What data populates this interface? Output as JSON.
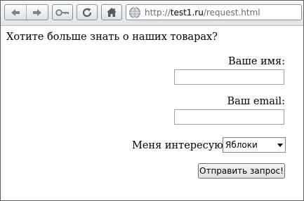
{
  "browser": {
    "url_scheme": "http://",
    "url_host": "test1.ru",
    "url_path": "/request.html",
    "icons": [
      "back-arrow-icon",
      "forward-arrow-icon",
      "key-icon",
      "reload-icon",
      "home-icon",
      "globe-icon"
    ]
  },
  "page": {
    "question": "Хотите больше знать о наших товарах?",
    "name_label": "Ваше имя:",
    "name_value": "",
    "email_label": "Ваш email:",
    "email_value": "",
    "interest_label": "Меня интересуют:",
    "interest_selected": "Яблоки",
    "submit_label": "Отправить запрос!"
  }
}
